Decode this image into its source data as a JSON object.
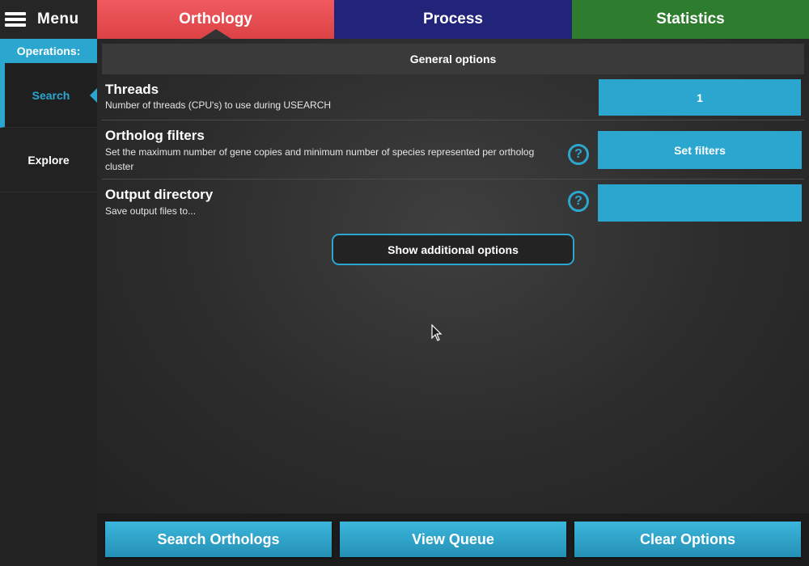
{
  "menu": {
    "label": "Menu",
    "icon": "hamburger-icon"
  },
  "tabs": [
    {
      "label": "Orthology",
      "color": "#e84a4e",
      "active": true
    },
    {
      "label": "Process",
      "color": "#22247a",
      "active": false
    },
    {
      "label": "Statistics",
      "color": "#2e7d2e",
      "active": false
    }
  ],
  "sidebar": {
    "header": "Operations:",
    "items": [
      {
        "label": "Search",
        "active": true
      },
      {
        "label": "Explore",
        "active": false
      }
    ]
  },
  "main": {
    "section_header": "General options",
    "options": [
      {
        "title": "Threads",
        "description": "Number of threads (CPU's) to use during USEARCH",
        "control_value": "1",
        "has_help": false
      },
      {
        "title": "Ortholog filters",
        "description": "Set the maximum number of gene copies and minimum number of species represented per ortholog cluster",
        "control_value": "Set filters",
        "has_help": true
      },
      {
        "title": "Output directory",
        "description": "Save output files to...",
        "control_value": "",
        "has_help": true
      }
    ],
    "show_more_label": "Show additional options"
  },
  "footer": {
    "buttons": [
      "Search Orthologs",
      "View Queue",
      "Clear Options"
    ]
  },
  "colors": {
    "accent": "#2aa6cf",
    "background": "#1c1c1c"
  }
}
